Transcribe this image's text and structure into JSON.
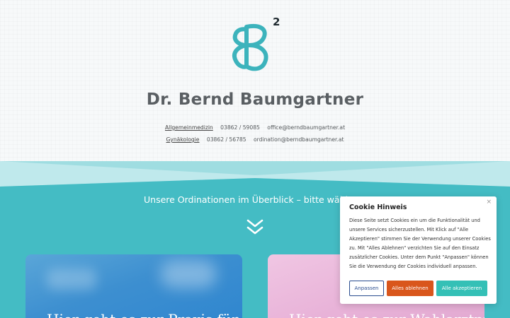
{
  "header": {
    "logo_superscript": "2",
    "title": "Dr. Bernd Baumgartner",
    "contacts": [
      {
        "specialty": "Allgemeinmedizin",
        "phone": "03862 / 59085",
        "email": "office@berndbaumgartner.at"
      },
      {
        "specialty": "Gynäkologie",
        "phone": "03862 / 56785",
        "email": "ordination@berndbaumgartner.at"
      }
    ]
  },
  "main": {
    "intro_text": "Unsere Ordinationen im Überblick – bitte wähl",
    "cards": [
      {
        "title": "Hier geht es zur Praxis für"
      },
      {
        "title": "Hier geht es zur Wahlarztpraxis"
      }
    ]
  },
  "cookie_banner": {
    "title": "Cookie Hinweis",
    "close": "×",
    "text": "Diese Seite setzt Cookies ein um die Funktionalität und unsere Services sicherzustellen. Mit Klick auf \"Alle Akzeptieren\" stimmen Sie der Verwendung unserer Cookies zu. Mit \"Alles Ablehnen\" verzichten Sie auf den Einsatz zusätzlicher Cookies. Unter dem Punkt \"Anpassen\" können Sie die Verwendung der Cookies individuell anpassen.",
    "buttons": {
      "customize": "Anpassen",
      "reject": "Alles ablehnen",
      "accept": "Alle akzeptieren"
    }
  },
  "colors": {
    "teal": "#44bcc4",
    "teal_light": "#9fdde1",
    "reject": "#d9561c",
    "accept": "#34c0b6",
    "customize_border": "#2a4d8f"
  },
  "icons": {
    "logo": "bb-logo-icon",
    "scroll": "double-chevron-down-icon",
    "close": "close-icon"
  }
}
